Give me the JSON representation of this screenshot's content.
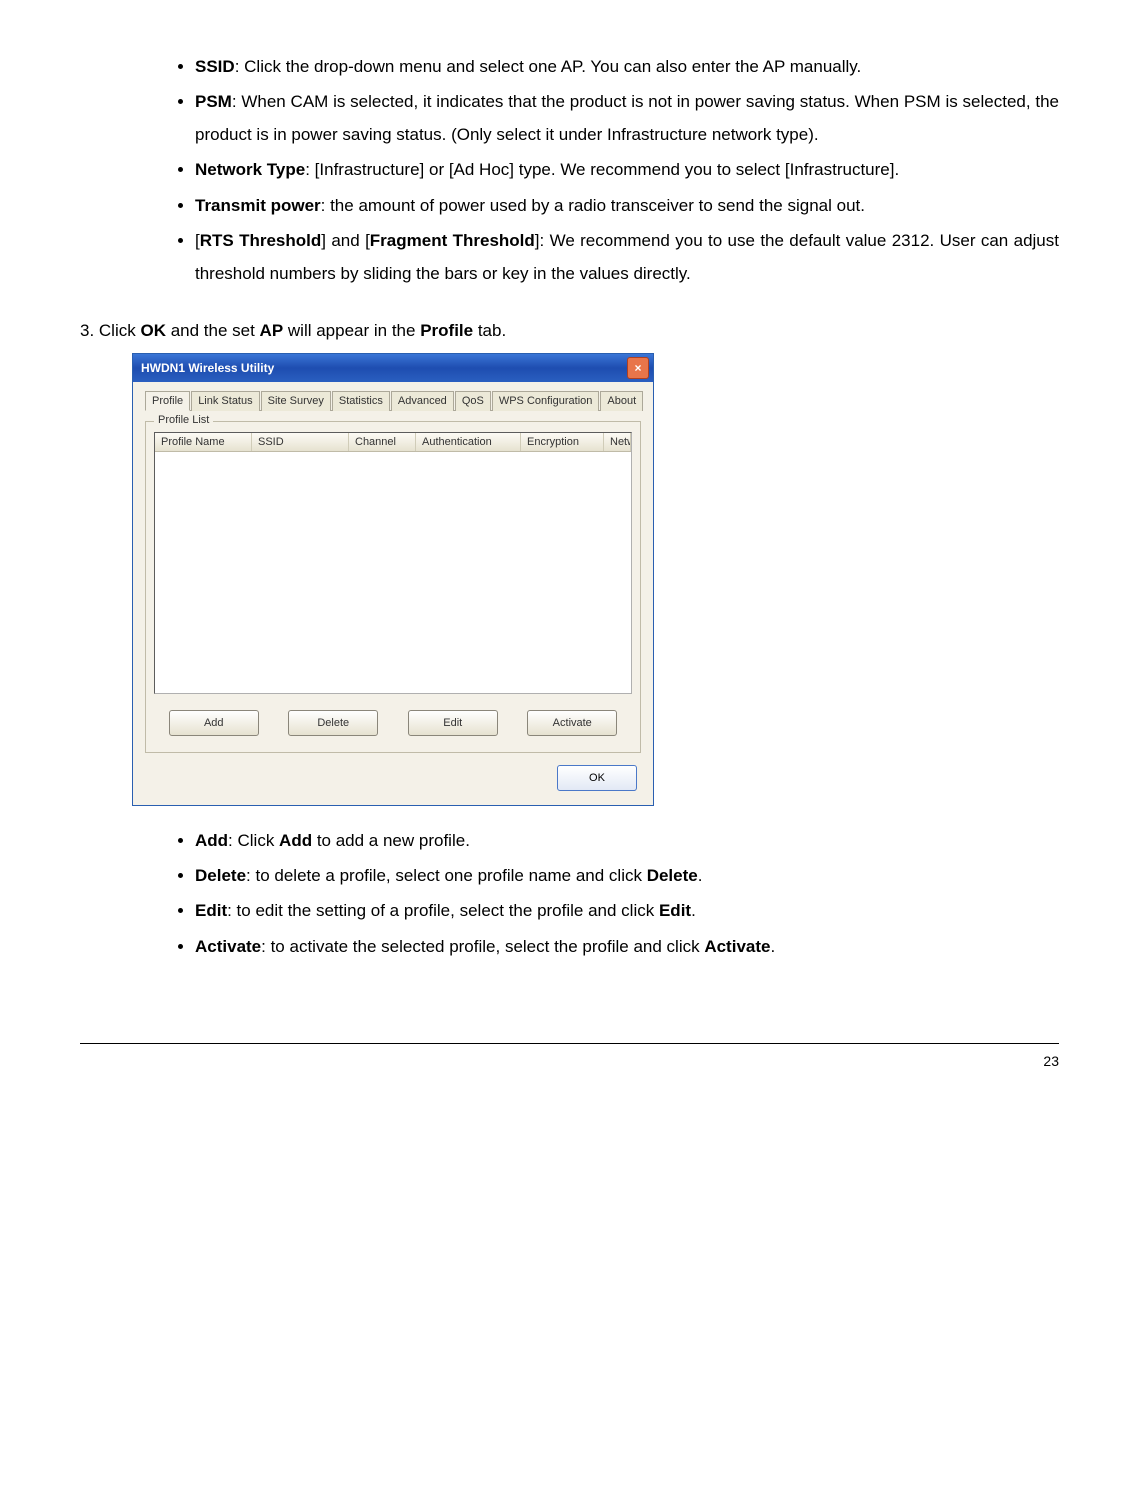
{
  "bullets_top": [
    {
      "term": "SSID",
      "after": ": Click the drop-down menu and select one AP. You can also enter the AP manually."
    },
    {
      "term": "PSM",
      "after": ": When CAM is selected, it indicates that the product is not in power saving status. When PSM is selected, the product is in power saving status. (Only select it under Infrastructure network type)."
    },
    {
      "term": "Network Type",
      "after": ": [Infrastructure] or [Ad Hoc] type. We recommend you to select [Infrastructure]."
    },
    {
      "term": "Transmit power",
      "after": ": the amount of power used by a radio transceiver to send the signal out."
    }
  ],
  "rts_item": {
    "pre": "[",
    "b1": "RTS Threshold",
    "mid": "] and [",
    "b2": "Fragment Threshold",
    "after": "]: We recommend you to use the default value 2312. User can adjust threshold numbers by sliding the bars or key in the values directly."
  },
  "step3": {
    "prefix": "3. Click ",
    "ok": "OK",
    "mid1": " and the set ",
    "ap": "AP",
    "mid2": " will appear in the ",
    "profile": "Profile",
    "suffix": " tab."
  },
  "window": {
    "title": "HWDN1 Wireless Utility",
    "close": "×",
    "tabs": [
      "Profile",
      "Link Status",
      "Site Survey",
      "Statistics",
      "Advanced",
      "QoS",
      "WPS Configuration",
      "About"
    ],
    "group_label": "Profile List",
    "columns": [
      "Profile Name",
      "SSID",
      "Channel",
      "Authentication",
      "Encryption",
      "Network Ty..."
    ],
    "buttons": [
      "Add",
      "Delete",
      "Edit",
      "Activate"
    ],
    "ok": "OK"
  },
  "bullets_bottom": [
    {
      "term": "Add",
      "after_pre": ": Click ",
      "term2": "Add",
      "after": " to add a new profile."
    },
    {
      "term": "Delete",
      "after_pre": ": to delete a profile, select one profile name and click ",
      "term2": "Delete",
      "after": "."
    },
    {
      "term": "Edit",
      "after_pre": ": to edit the setting of a profile, select the profile and click ",
      "term2": "Edit",
      "after": "."
    },
    {
      "term": "Activate",
      "after_pre": ": to activate the selected profile, select the profile and click ",
      "term2": "Activate",
      "after": "."
    }
  ],
  "page_number": "23"
}
